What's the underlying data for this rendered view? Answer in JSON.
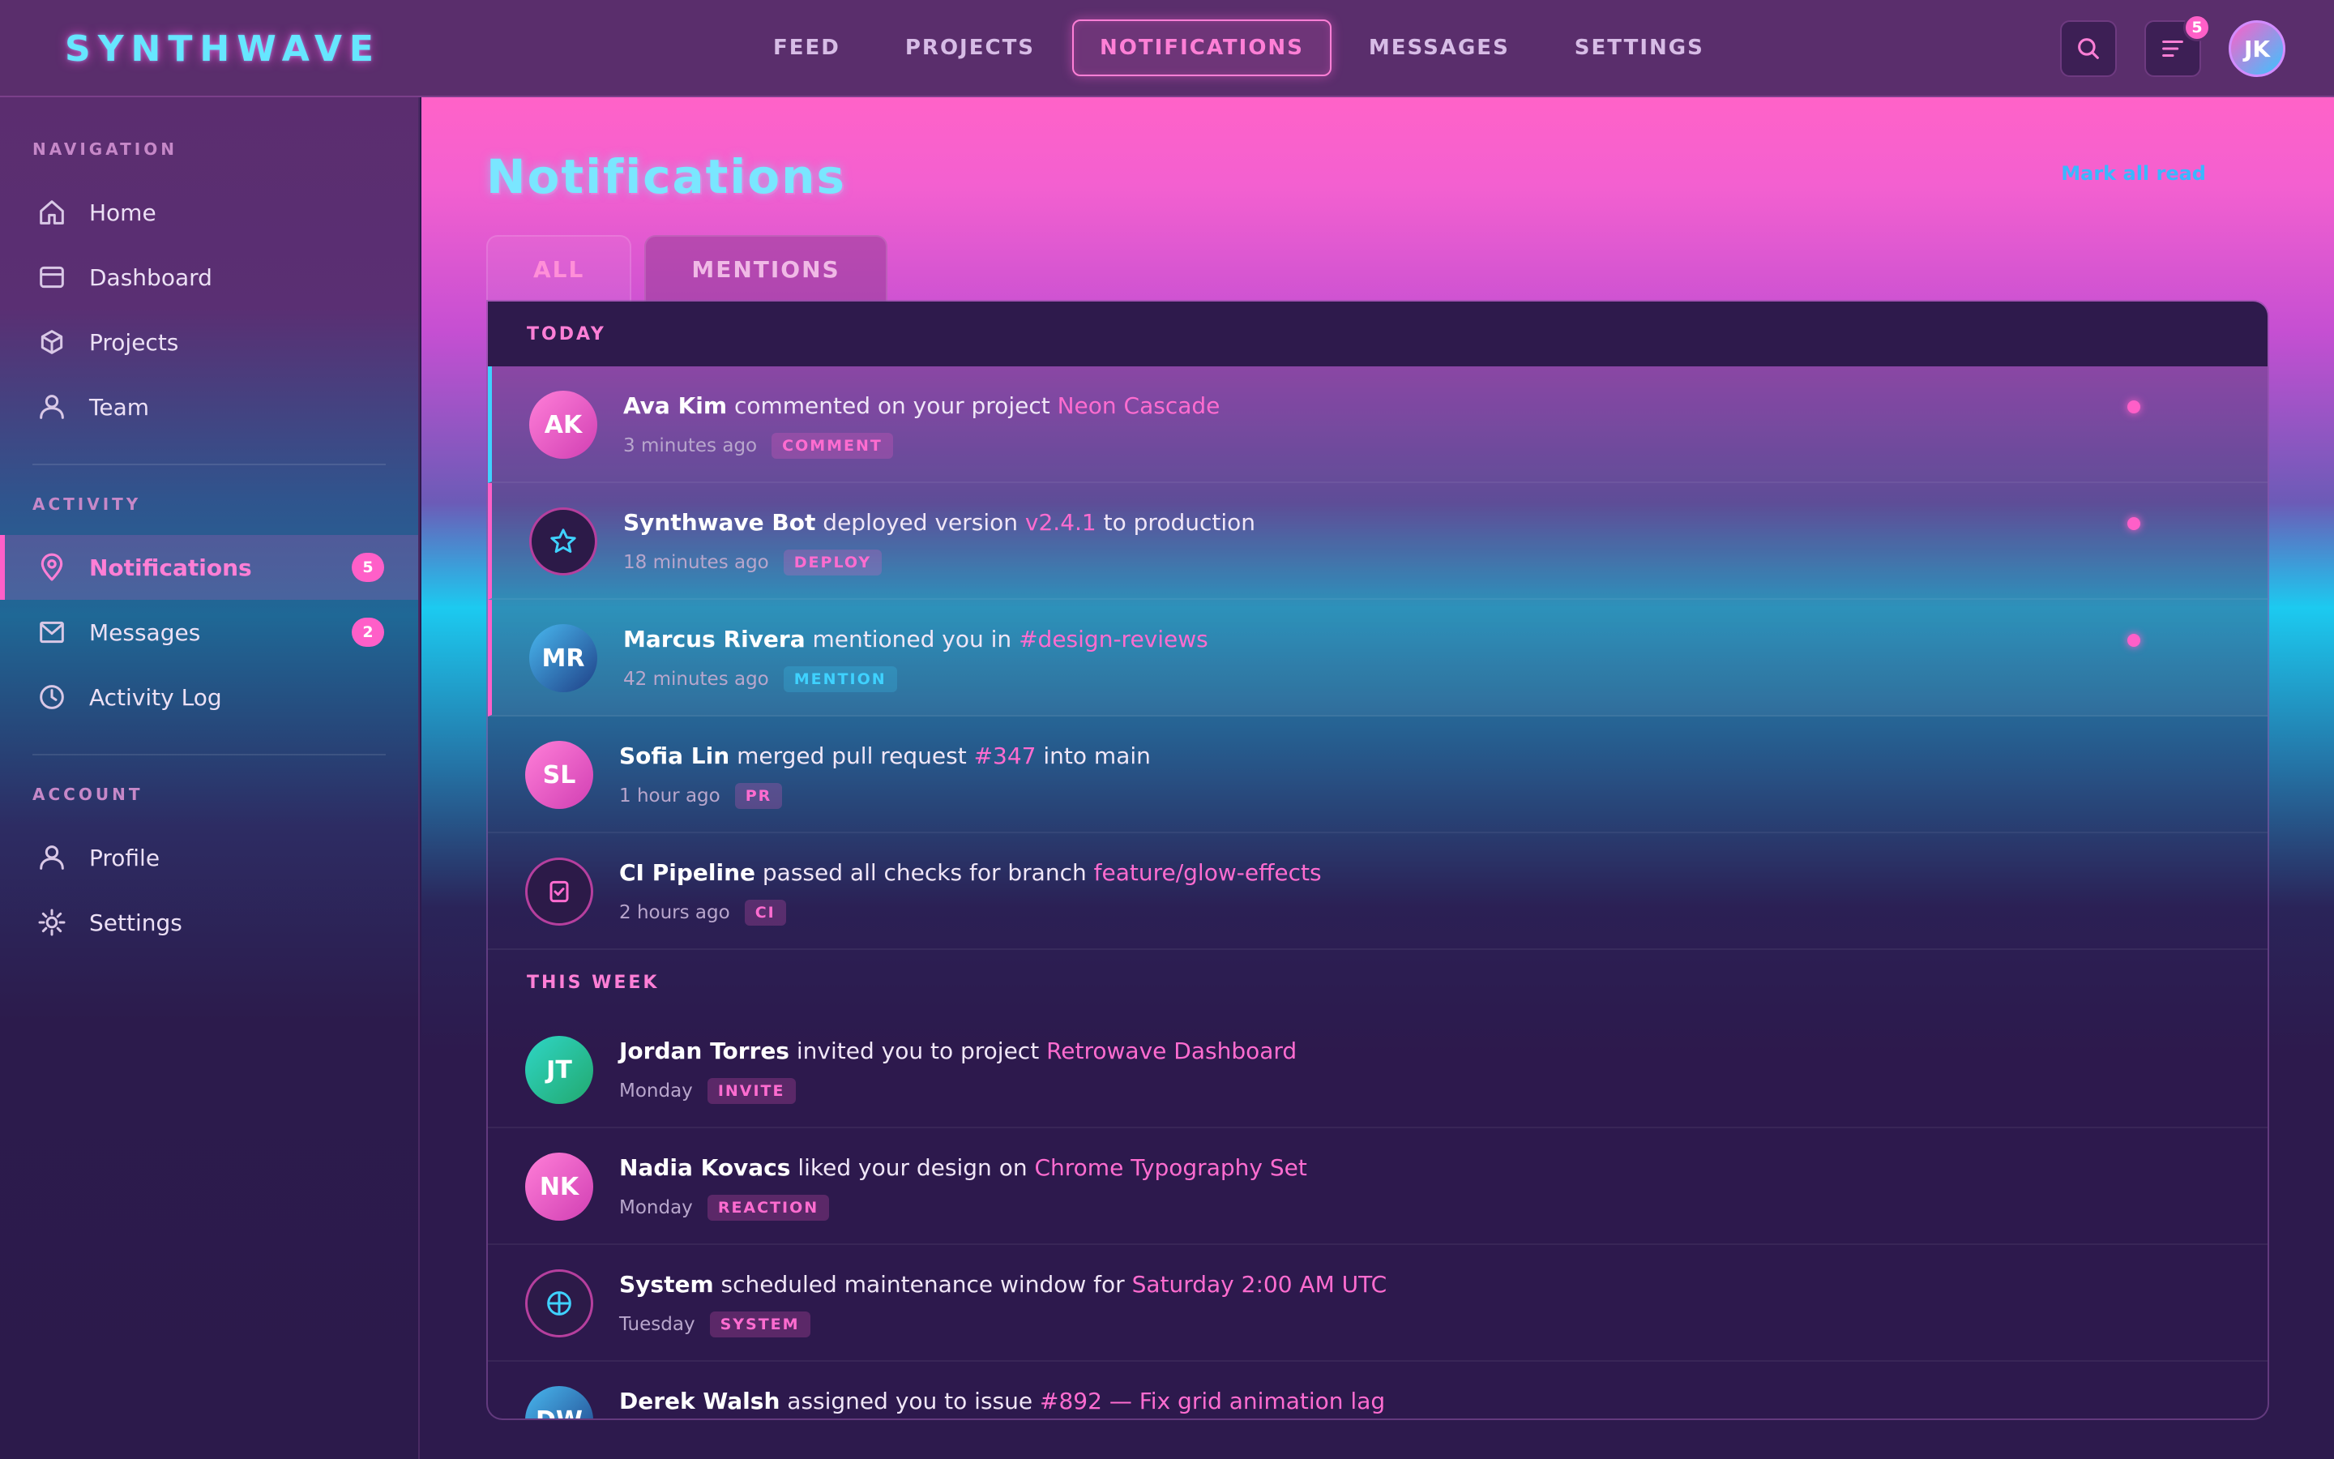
{
  "app": {
    "brand": "SYNTHWAVE"
  },
  "topnav": {
    "items": [
      "FEED",
      "PROJECTS",
      "NOTIFICATIONS",
      "MESSAGES",
      "SETTINGS"
    ],
    "active": "NOTIFICATIONS"
  },
  "topbar": {
    "notification_count": "5",
    "user_initials": "JK"
  },
  "sidebar": {
    "sections": {
      "navigation": "NAVIGATION",
      "activity": "ACTIVITY",
      "account": "ACCOUNT"
    },
    "items": [
      {
        "label": "Home",
        "icon": "home-icon"
      },
      {
        "label": "Dashboard",
        "icon": "dashboard-icon"
      },
      {
        "label": "Projects",
        "icon": "cube-icon"
      },
      {
        "label": "Team",
        "icon": "user-icon"
      },
      {
        "label": "Notifications",
        "icon": "pin-icon",
        "badge": "5",
        "active": true
      },
      {
        "label": "Messages",
        "icon": "mail-icon",
        "badge": "2"
      },
      {
        "label": "Activity Log",
        "icon": "clock-icon"
      },
      {
        "label": "Profile",
        "icon": "user-icon"
      },
      {
        "label": "Settings",
        "icon": "gear-icon"
      }
    ]
  },
  "main": {
    "title": "Notifications",
    "mark_all_read": "Mark all read",
    "tabs": [
      {
        "label": "ALL",
        "active": true
      },
      {
        "label": "MENTIONS",
        "active": false
      }
    ],
    "groups": {
      "today": "TODAY",
      "this_week": "THIS WEEK"
    },
    "notifications": [
      {
        "initials": "AK",
        "actor": "Ava Kim",
        "action": " commented on your project ",
        "target": "Neon Cascade",
        "after": "",
        "time": "3 minutes ago",
        "tag": "COMMENT",
        "unread": true
      },
      {
        "initials": "",
        "icon": "star-icon",
        "actor": "Synthwave Bot",
        "action": " deployed version ",
        "target": "v2.4.1",
        "after": " to production",
        "time": "18 minutes ago",
        "tag": "DEPLOY",
        "unread": true
      },
      {
        "initials": "MR",
        "actor": "Marcus Rivera",
        "action": " mentioned you in ",
        "target": "#design-reviews",
        "after": "",
        "time": "42 minutes ago",
        "tag": "MENTION",
        "unread": true
      },
      {
        "initials": "SL",
        "actor": "Sofia Lin",
        "action": " merged pull request ",
        "target": "#347",
        "after": " into main",
        "time": "1 hour ago",
        "tag": "PR",
        "unread": false
      },
      {
        "initials": "",
        "icon": "check-icon",
        "actor": "CI Pipeline",
        "action": " passed all checks for branch ",
        "target": "feature/glow-effects",
        "after": "",
        "time": "2 hours ago",
        "tag": "CI",
        "unread": false
      },
      {
        "initials": "JT",
        "actor": "Jordan Torres",
        "action": " invited you to project ",
        "target": "Retrowave Dashboard",
        "after": "",
        "time": "Monday",
        "tag": "INVITE",
        "unread": false
      },
      {
        "initials": "NK",
        "actor": "Nadia Kovacs",
        "action": " liked your design on ",
        "target": "Chrome Typography Set",
        "after": "",
        "time": "Monday",
        "tag": "REACTION",
        "unread": false
      },
      {
        "initials": "",
        "icon": "target-icon",
        "actor": "System",
        "action": " scheduled maintenance window for ",
        "target": "Saturday 2:00 AM UTC",
        "after": "",
        "time": "Tuesday",
        "tag": "SYSTEM",
        "unread": false
      },
      {
        "initials": "DW",
        "actor": "Derek Walsh",
        "action": " assigned you to issue ",
        "target": "#892 — Fix grid animation lag",
        "after": "",
        "time": "",
        "tag": "",
        "unread": false
      }
    ]
  },
  "colors": {
    "accent_pink": "#ff5fc8",
    "accent_cyan": "#3fd2ff",
    "background": "#2d1a4d"
  }
}
